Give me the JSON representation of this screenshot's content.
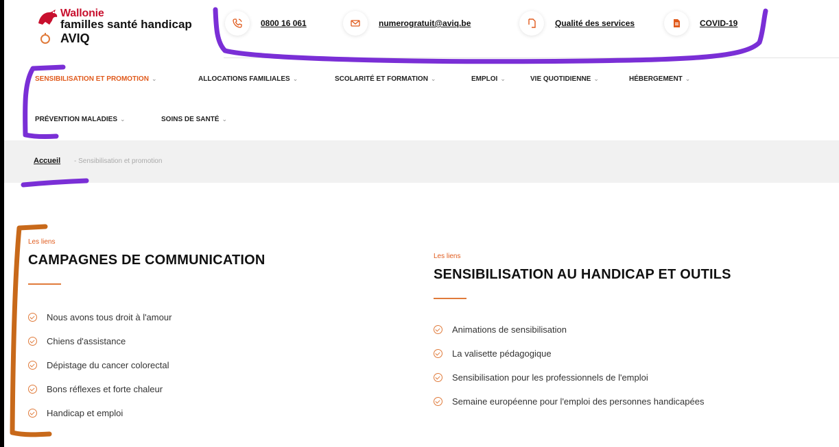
{
  "logo": {
    "line1": "Wallonie",
    "line2": "familles santé handicap",
    "line3": "AVIQ"
  },
  "contacts": [
    {
      "icon": "phone-icon",
      "label": "0800 16 061"
    },
    {
      "icon": "mail-icon",
      "label": "numerogratuit@aviq.be"
    },
    {
      "icon": "document-icon",
      "label": "Qualité des services"
    },
    {
      "icon": "file-icon",
      "label": "COVID-19"
    }
  ],
  "nav": [
    {
      "label": "SENSIBILISATION ET PROMOTION",
      "active": true
    },
    {
      "label": "ALLOCATIONS FAMILIALES"
    },
    {
      "label": "SCOLARITÉ ET FORMATION"
    },
    {
      "label": "EMPLOI"
    },
    {
      "label": "VIE QUOTIDIENNE"
    },
    {
      "label": "HÉBERGEMENT"
    },
    {
      "label": "PRÉVENTION MALADIES"
    },
    {
      "label": "SOINS DE SANTÉ"
    }
  ],
  "breadcrumb": {
    "home": "Accueil",
    "separator": "-",
    "current": "Sensibilisation et promotion"
  },
  "sections": [
    {
      "eyebrow": "Les liens",
      "title": "CAMPAGNES DE COMMUNICATION",
      "items": [
        "Nous avons tous droit à l'amour",
        "Chiens d'assistance",
        "Dépistage du cancer colorectal",
        "Bons réflexes et forte chaleur",
        "Handicap et emploi"
      ]
    },
    {
      "eyebrow": "Les liens",
      "title": "SENSIBILISATION AU HANDICAP ET OUTILS",
      "items": [
        "Animations de sensibilisation",
        "La valisette pédagogique",
        "Sensibilisation pour les professionnels de l'emploi",
        "Semaine européenne pour l'emploi des personnes handicapées"
      ]
    }
  ],
  "colors": {
    "accent": "#e05a1c",
    "brand_red": "#c8102e",
    "annotation_purple": "#7a2fd6",
    "annotation_orange": "#c8691a"
  }
}
